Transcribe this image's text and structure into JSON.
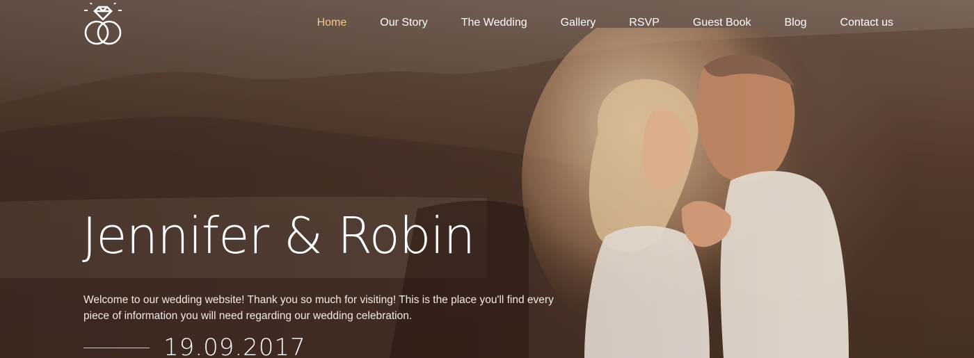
{
  "header": {
    "logo_icon": "rings-diamond-icon",
    "nav": [
      {
        "label": "Home",
        "active": true
      },
      {
        "label": "Our Story",
        "active": false
      },
      {
        "label": "The Wedding",
        "active": false
      },
      {
        "label": "Gallery",
        "active": false
      },
      {
        "label": "RSVP",
        "active": false
      },
      {
        "label": "Guest Book",
        "active": false
      },
      {
        "label": "Blog",
        "active": false
      },
      {
        "label": "Contact us",
        "active": false
      }
    ]
  },
  "hero": {
    "title": "Jennifer & Robin",
    "intro": "Welcome to our wedding website! Thank you so much for visiting! This is the place you'll find every piece of information you will need regarding our wedding celebration.",
    "date": "19.09.2017"
  },
  "colors": {
    "nav_active": "#f3c98b",
    "text": "#ffffff"
  }
}
